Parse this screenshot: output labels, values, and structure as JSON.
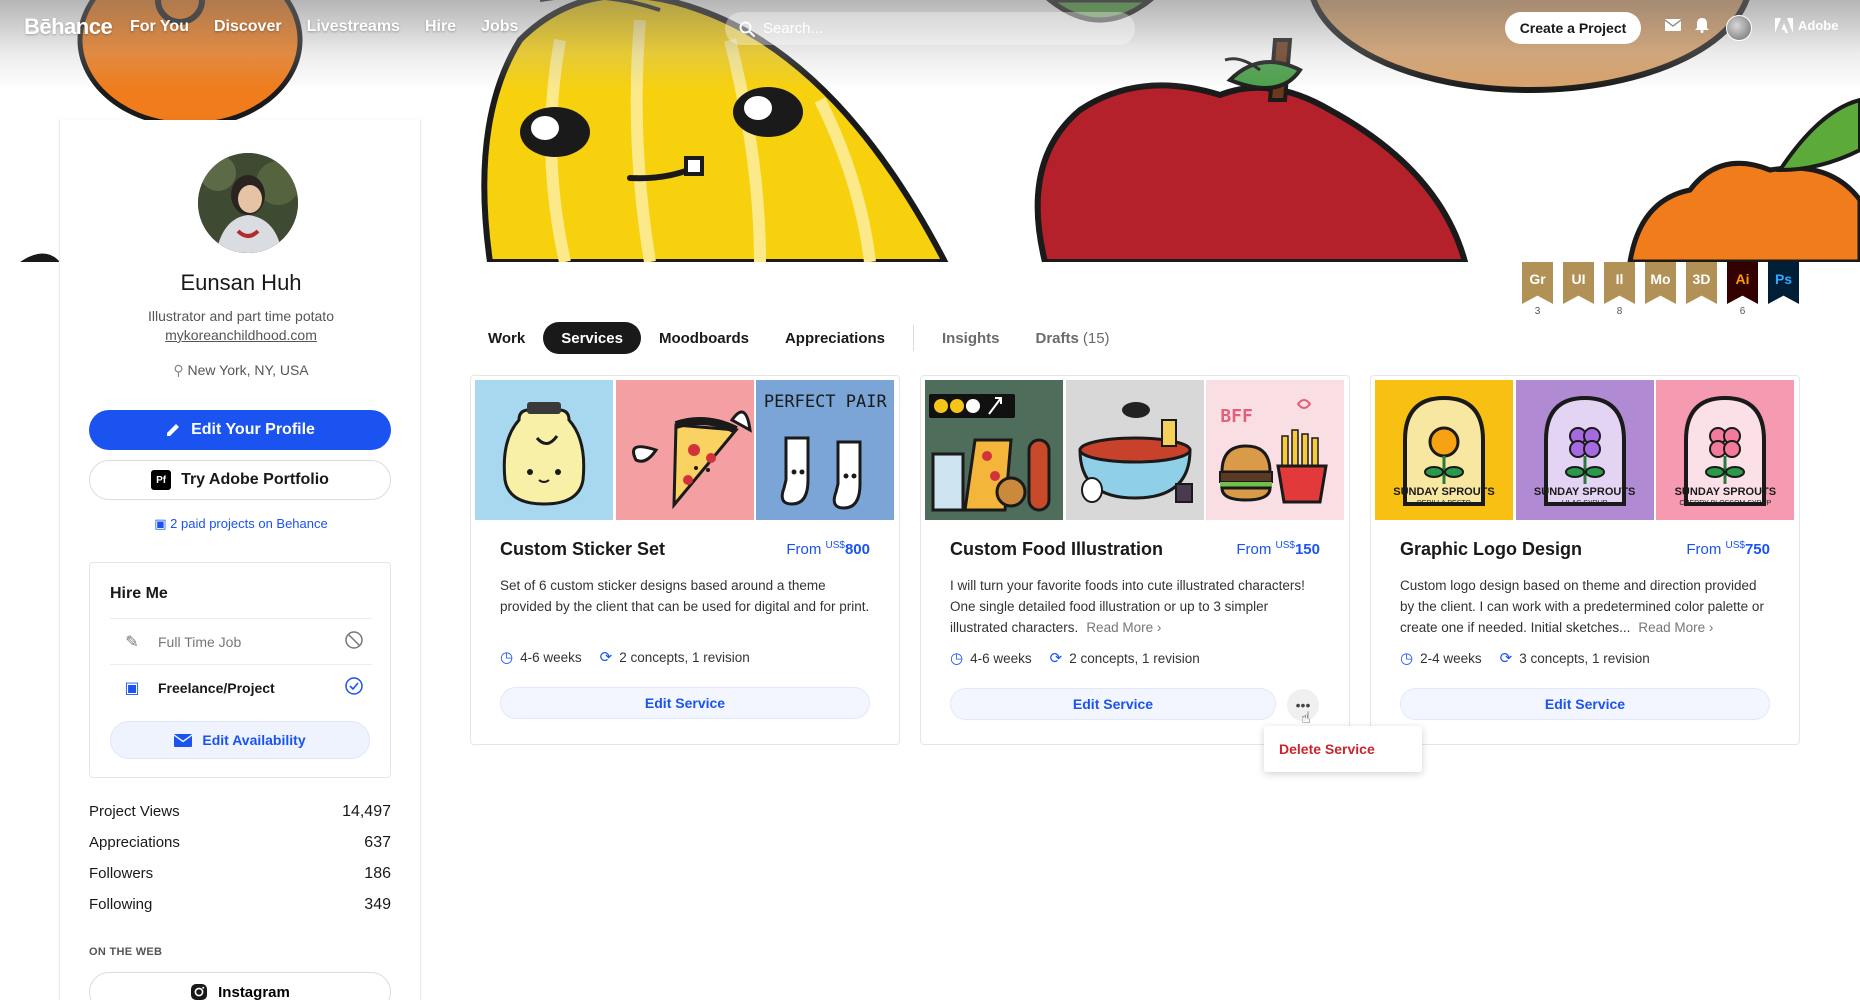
{
  "nav": {
    "logo": "Bēhance",
    "links": [
      "For You",
      "Discover",
      "Livestreams",
      "Hire",
      "Jobs"
    ],
    "search_placeholder": "Search...",
    "create_label": "Create a Project",
    "adobe_label": "Adobe",
    "icons": [
      "mail-icon",
      "bell-icon",
      "adobe-logo-icon"
    ]
  },
  "profile": {
    "name": "Eunsan Huh",
    "tagline": "Illustrator and part time potato",
    "website": "mykoreanchildhood.com",
    "location": "New York, NY, USA",
    "edit_profile": "Edit Your Profile",
    "portfolio_badge": "Pf",
    "try_portfolio": "Try Adobe Portfolio",
    "paid_projects": "2 paid projects on Behance"
  },
  "hire": {
    "title": "Hire Me",
    "full_time": "Full Time Job",
    "freelance": "Freelance/Project",
    "edit_availability": "Edit Availability"
  },
  "stats": [
    {
      "label": "Project Views",
      "value": "14,497"
    },
    {
      "label": "Appreciations",
      "value": "637"
    },
    {
      "label": "Followers",
      "value": "186"
    },
    {
      "label": "Following",
      "value": "349"
    }
  ],
  "on_web": {
    "heading": "ON THE WEB",
    "instagram": "Instagram"
  },
  "badges": [
    {
      "label": "Gr",
      "count": "3",
      "color": "#b19155"
    },
    {
      "label": "UI",
      "count": "",
      "color": "#b19155"
    },
    {
      "label": "Il",
      "count": "8",
      "color": "#b19155"
    },
    {
      "label": "Mo",
      "count": "",
      "color": "#b19155"
    },
    {
      "label": "3D",
      "count": "",
      "color": "#b19155"
    },
    {
      "label": "Ai",
      "count": "6",
      "color": "#330000"
    },
    {
      "label": "Ps",
      "count": "",
      "color": "#001e36"
    }
  ],
  "tabs": {
    "work": "Work",
    "services": "Services",
    "moodboards": "Moodboards",
    "appreciations": "Appreciations",
    "insights": "Insights",
    "drafts": "Drafts",
    "drafts_count": "(15)"
  },
  "services": [
    {
      "title": "Custom Sticker Set",
      "price_prefix": "From ",
      "currency": "US$",
      "price": "800",
      "desc": "Set of 6 custom sticker designs based around a theme provided by the client that can be used for digital and for print.",
      "read_more": "",
      "duration": "4-6 weeks",
      "revisions": "2 concepts, 1 revision",
      "edit": "Edit Service",
      "thumb_text": "PERFECT PAIR"
    },
    {
      "title": "Custom Food Illustration",
      "price_prefix": "From ",
      "currency": "US$",
      "price": "150",
      "desc": "I will turn your favorite foods into cute illustrated characters! One single detailed food illustration or up to 3 simpler illustrated characters.",
      "read_more": "Read More ›",
      "duration": "4-6 weeks",
      "revisions": "2 concepts, 1 revision",
      "edit": "Edit Service",
      "thumb_text": "BFF",
      "more": "•••"
    },
    {
      "title": "Graphic Logo Design",
      "price_prefix": "From ",
      "currency": "US$",
      "price": "750",
      "desc": "Custom logo design based on theme and direction provided by the client. I can work with a predetermined color palette or create one if needed. Initial sketches...",
      "read_more": "Read More ›",
      "duration": "2-4 weeks",
      "revisions": "3 concepts, 1 revision",
      "edit": "Edit Service",
      "logo_title": "SUNDAY SPROUTS",
      "logo_subs": [
        "PERILLA PESTO",
        "LILAC SYRUP",
        "CHERRY BLOSSOM SYRUP"
      ]
    }
  ],
  "dropdown": {
    "delete": "Delete Service"
  }
}
